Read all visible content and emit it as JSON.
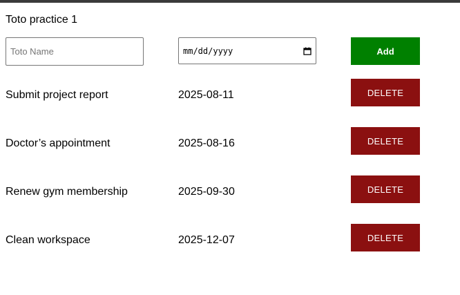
{
  "app": {
    "title": "Toto practice 1"
  },
  "form": {
    "name_placeholder": "Toto Name",
    "name_value": "",
    "date_placeholder": "mm/dd/yyyy",
    "add_label": "Add"
  },
  "todos": [
    {
      "name": "Submit project report",
      "date": "2025-08-11",
      "delete_label": "DELETE"
    },
    {
      "name": "Doctor’s appointment",
      "date": "2025-08-16",
      "delete_label": "DELETE"
    },
    {
      "name": "Renew gym membership",
      "date": "2025-09-30",
      "delete_label": "DELETE"
    },
    {
      "name": "Clean workspace",
      "date": "2025-12-07",
      "delete_label": "DELETE"
    }
  ],
  "colors": {
    "add_button": "#008000",
    "delete_button": "#8b1010",
    "top_bar": "#3a3a3a"
  },
  "icons": {
    "date_picker": "calendar-icon"
  }
}
